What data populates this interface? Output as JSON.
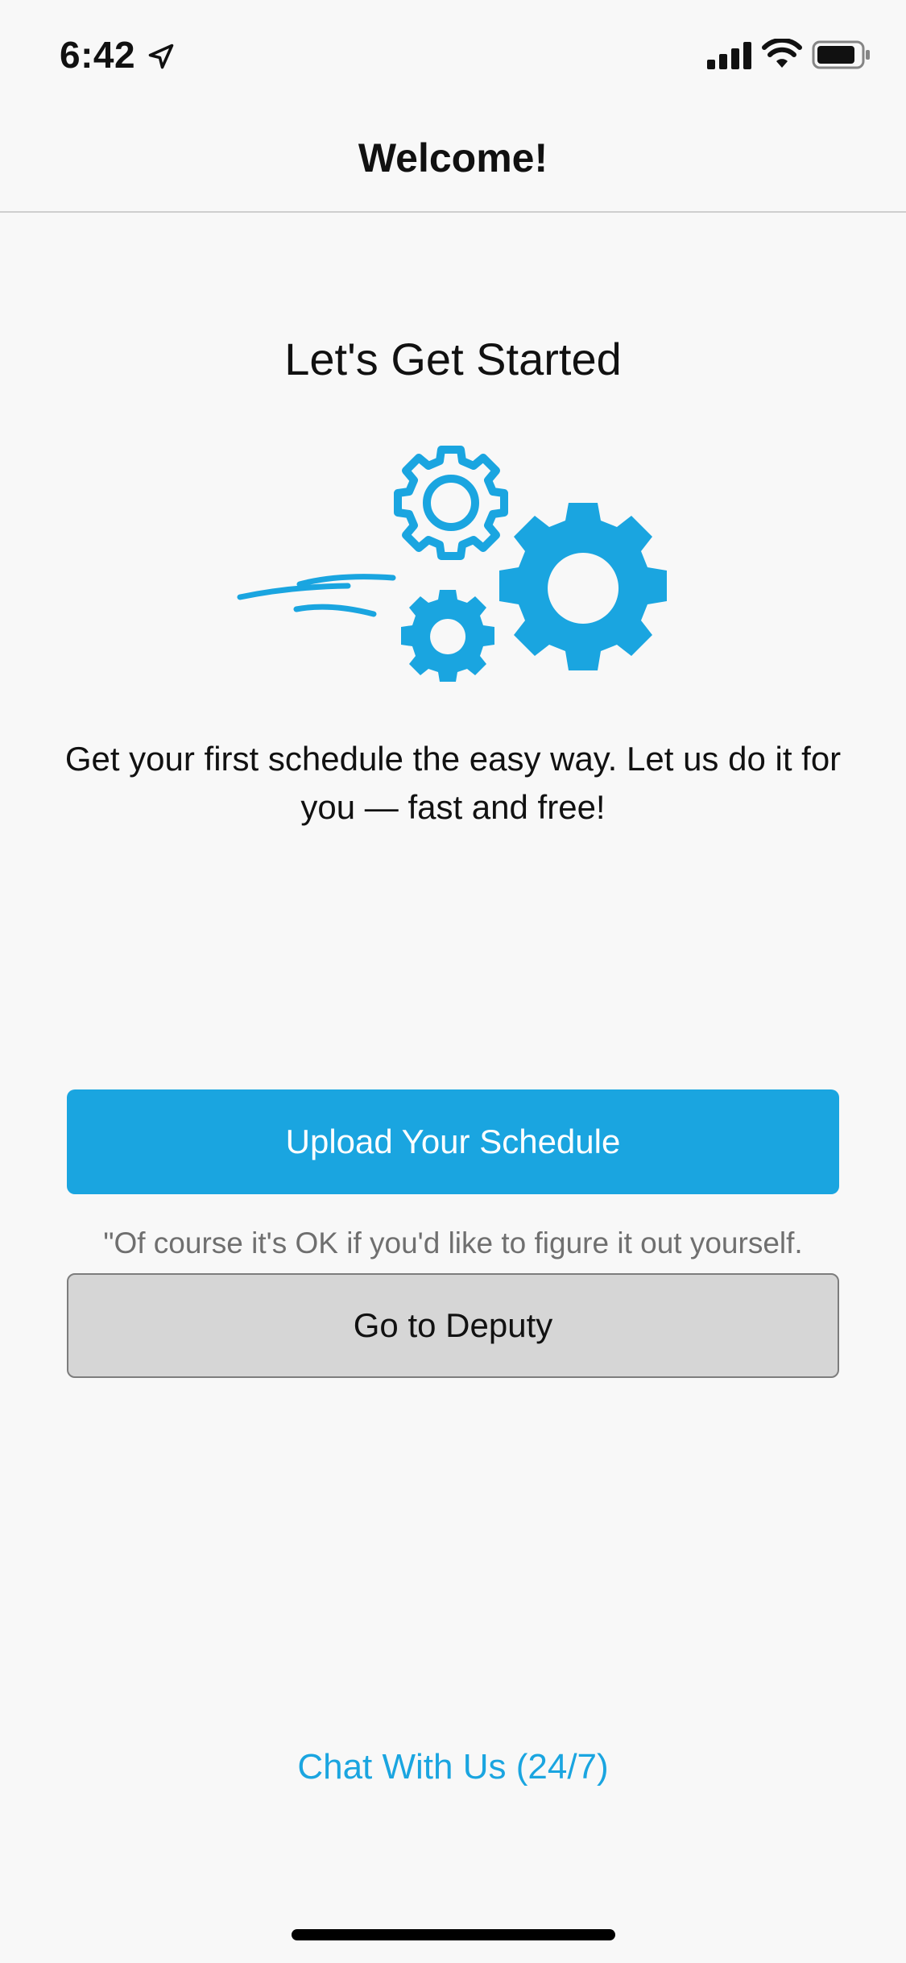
{
  "status_bar": {
    "time": "6:42",
    "location_icon": "location-arrow-icon",
    "signal_icon": "cellular-signal-icon",
    "wifi_icon": "wifi-icon",
    "battery_icon": "battery-icon"
  },
  "nav": {
    "title": "Welcome!"
  },
  "main": {
    "heading": "Let's Get Started",
    "illustration_icon": "gears-icon",
    "description": "Get your first schedule the easy way. Let us do it for you — fast and free!",
    "upload_button": "Upload Your Schedule",
    "hint": "\"Of course it's OK if you'd like to figure it out yourself.",
    "deputy_button": "Go to Deputy",
    "chat_link": "Chat With Us (24/7)"
  },
  "colors": {
    "accent": "#1aa5e0",
    "secondary_button": "#d6d6d6",
    "background": "#f8f8f8",
    "hint_text": "#6f6f6f"
  }
}
